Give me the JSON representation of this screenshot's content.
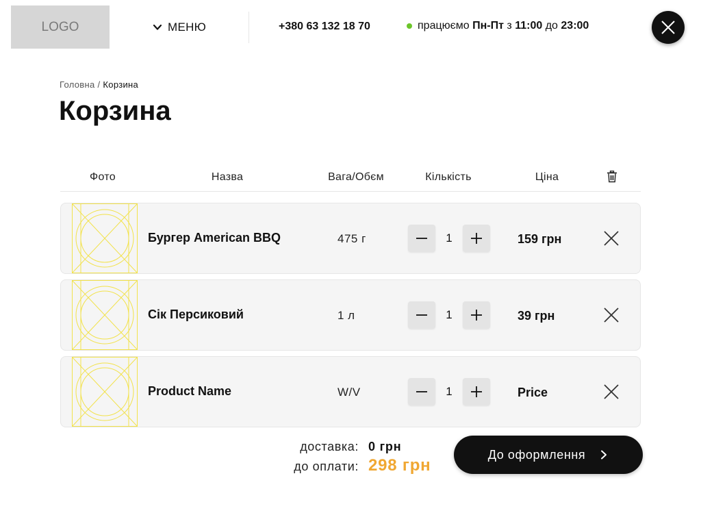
{
  "header": {
    "logo_text": "LOGO",
    "menu_label": "МЕНЮ",
    "phone": "+380 63 132 18 70",
    "hours": {
      "prefix": "працюємо",
      "days": "Пн-Пт",
      "from_word": "з",
      "from_time": "11:00",
      "to_word": "до",
      "to_time": "23:00",
      "status_color": "#6cc52a"
    },
    "close_icon": "close-icon"
  },
  "breadcrumb": {
    "home": "Головна",
    "separator": "/",
    "current": "Корзина"
  },
  "page_title": "Корзина",
  "table": {
    "columns": {
      "photo": "Фото",
      "name": "Назва",
      "weight": "Вага/Обєм",
      "quantity": "Кількість",
      "price": "Ціна"
    },
    "clear_icon": "trash-icon",
    "rows": [
      {
        "name": "Бургер American BBQ",
        "weight": "475 г",
        "quantity": "1",
        "price": "159 грн"
      },
      {
        "name": "Сік Персиковий",
        "weight": "1 л",
        "quantity": "1",
        "price": "39 грн"
      },
      {
        "name": "Product Name",
        "weight": "W/V",
        "quantity": "1",
        "price": "Price"
      }
    ]
  },
  "summary": {
    "delivery_label": "доставка:",
    "delivery_value": "0 грн",
    "total_label": "до оплати:",
    "total_value": "298 грн",
    "total_color": "#f0a732"
  },
  "checkout": {
    "label": "До оформлення"
  },
  "colors": {
    "accent": "#f0a732",
    "dark": "#111111",
    "placeholder_yellow": "#f2e24a"
  }
}
